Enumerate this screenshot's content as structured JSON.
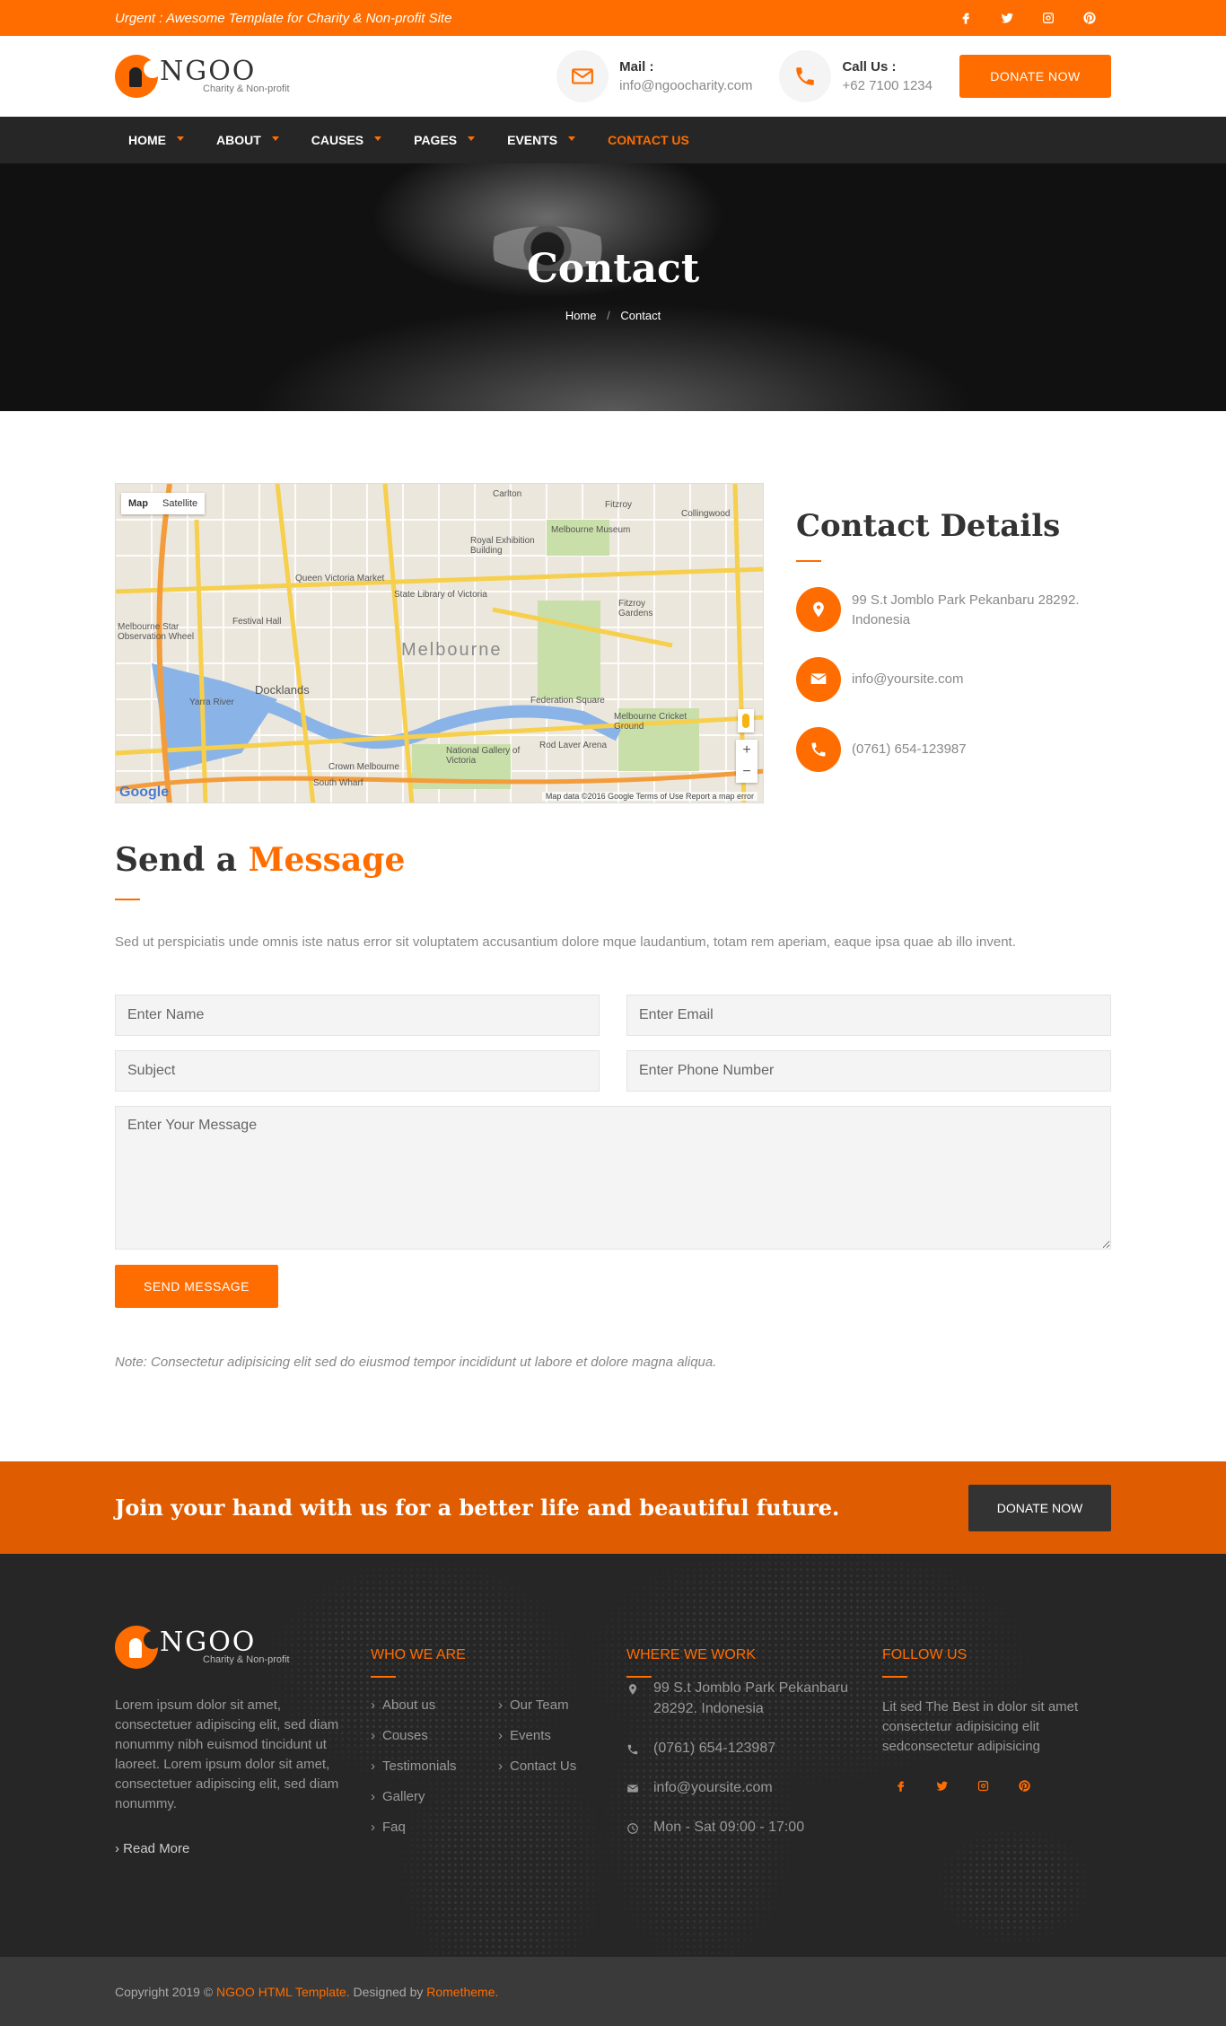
{
  "topbar": {
    "urgent": "Urgent : Awesome Template for Charity & Non-profit Site"
  },
  "brand": {
    "name": "NGOO",
    "tagline": "Charity & Non-profit"
  },
  "header": {
    "mail_label": "Mail :",
    "mail_value": "info@ngoocharity.com",
    "call_label": "Call Us :",
    "call_value": "+62 7100 1234",
    "donate": "DONATE NOW"
  },
  "nav": {
    "items": [
      {
        "label": "HOME"
      },
      {
        "label": "ABOUT"
      },
      {
        "label": "CAUSES"
      },
      {
        "label": "PAGES"
      },
      {
        "label": "EVENTS"
      },
      {
        "label": "CONTACT US"
      }
    ]
  },
  "hero": {
    "title": "Contact",
    "crumb_home": "Home",
    "crumb_sep": "/",
    "crumb_current": "Contact"
  },
  "map": {
    "tab_map": "Map",
    "tab_satellite": "Satellite",
    "city": "Melbourne",
    "labels": [
      "Carlton",
      "Fitzroy",
      "Collingwood",
      "Melbourne Museum",
      "Royal Exhibition Building",
      "Queen Victoria Market",
      "State Library of Victoria",
      "Festival Hall",
      "Docklands",
      "Yarra River",
      "Federation Square",
      "Melbourne Cricket Ground",
      "National Gallery of Victoria",
      "South Wharf",
      "Crown Melbourne",
      "Rod Laver Arena",
      "Fitzroy Gardens",
      "Melbourne Star Observation Wheel"
    ],
    "attribution": "Map data ©2016 Google   Terms of Use   Report a map error",
    "google": "Google",
    "zoom_in": "+",
    "zoom_out": "−"
  },
  "details": {
    "title": "Contact Details",
    "address": "99 S.t Jomblo Park Pekanbaru 28292. Indonesia",
    "email": "info@yoursite.com",
    "phone": "(0761) 654-123987"
  },
  "message": {
    "title_a": "Send a",
    "title_b": "Message",
    "intro": "Sed ut perspiciatis unde omnis iste natus error sit voluptatem accusantium dolore mque laudantium, totam rem aperiam, eaque ipsa quae ab illo invent.",
    "ph_name": "Enter Name",
    "ph_email": "Enter Email",
    "ph_subject": "Subject",
    "ph_phone": "Enter Phone Number",
    "ph_message": "Enter Your Message",
    "send": "SEND MESSAGE",
    "note": "Note: Consectetur adipisicing elit sed do eiusmod tempor incididunt ut labore et dolore magna aliqua."
  },
  "cta": {
    "text": "Join your hand with us for a better life and beautiful future.",
    "button": "DONATE NOW"
  },
  "footer": {
    "about": "Lorem ipsum dolor sit amet, consectetuer adipiscing elit, sed diam nonummy nibh euismod tincidunt ut laoreet. Lorem ipsum dolor sit amet, consectetuer adipiscing elit, sed diam nonummy.",
    "read_more": "› Read More",
    "who_title": "WHO WE ARE",
    "links_a": [
      "About us",
      "Couses",
      "Testimonials",
      "Gallery",
      "Faq"
    ],
    "links_b": [
      "Our Team",
      "Events",
      "Contact Us"
    ],
    "where_title": "WHERE WE WORK",
    "where_address": "99 S.t Jomblo Park Pekanbaru 28292. Indonesia",
    "where_phone": "(0761) 654-123987",
    "where_email": "info@yoursite.com",
    "where_hours": "Mon - Sat 09:00 - 17:00",
    "follow_title": "FOLLOW US",
    "follow_text": "Lit sed The Best in dolor sit amet consectetur adipisicing elit sedconsectetur adipisicing"
  },
  "bottom": {
    "copy": "Copyright 2019 ©",
    "template": "NGOO HTML Template.",
    "designed": "Designed by",
    "author": "Rometheme."
  },
  "colors": {
    "accent": "#ff6d00",
    "dark": "#262626",
    "cta": "#e05c00"
  },
  "icons": [
    "facebook-icon",
    "twitter-icon",
    "instagram-icon",
    "pinterest-icon",
    "mail-icon",
    "phone-icon",
    "map-marker-icon",
    "envelope-icon",
    "clock-icon"
  ]
}
